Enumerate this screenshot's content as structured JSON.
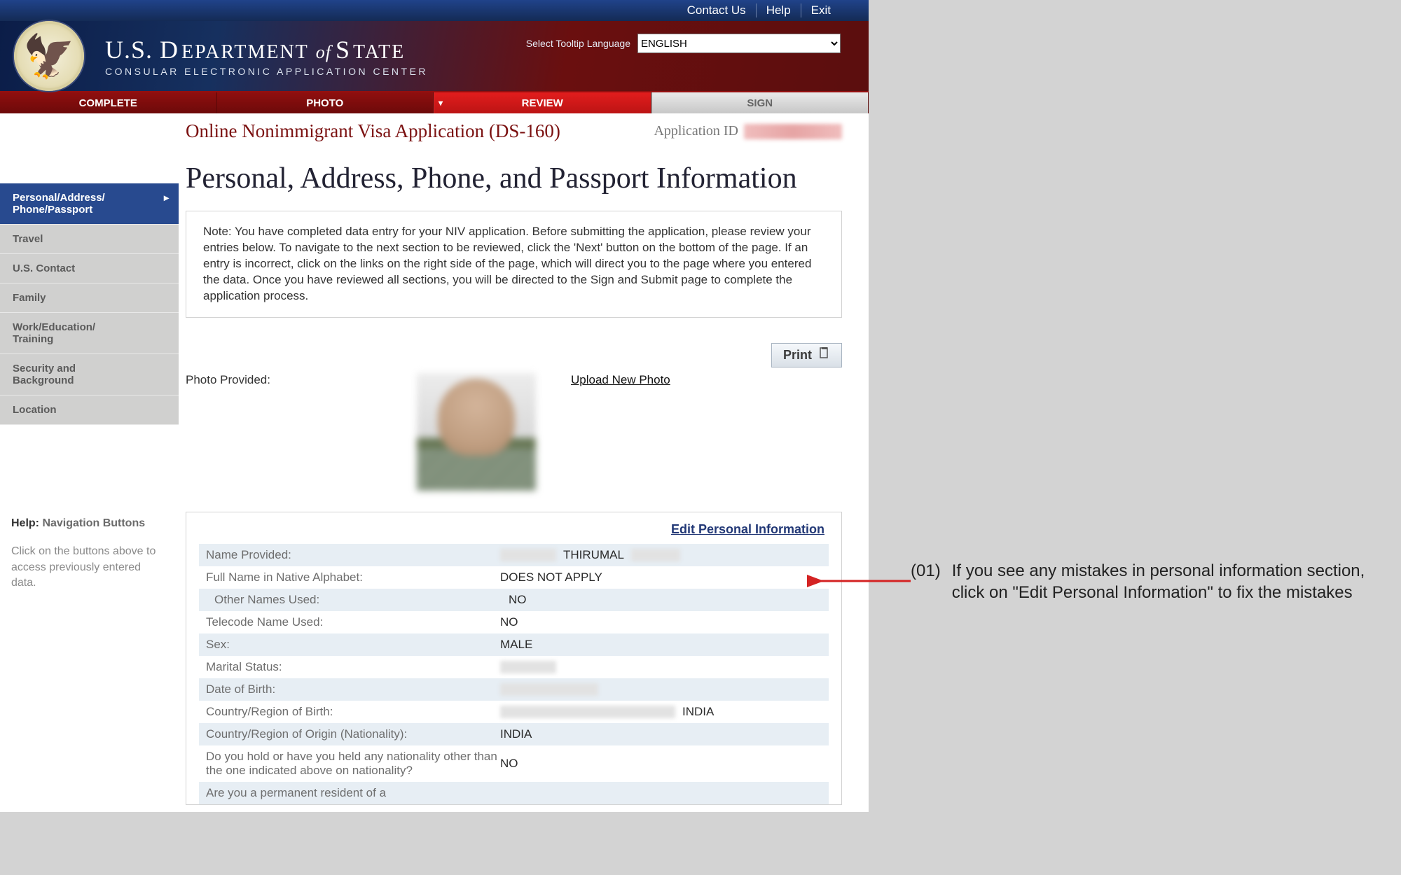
{
  "topbar": {
    "contact": "Contact Us",
    "help": "Help",
    "exit": "Exit"
  },
  "department": {
    "name_html": "U.S. DEPARTMENT of STATE",
    "sub": "CONSULAR ELECTRONIC APPLICATION CENTER"
  },
  "tooltip": {
    "label": "Select Tooltip Language",
    "value": "ENGLISH"
  },
  "tabs": {
    "complete": "COMPLETE",
    "photo": "PHOTO",
    "review": "REVIEW",
    "sign": "SIGN"
  },
  "form": {
    "title": "Online Nonimmigrant Visa Application (DS-160)",
    "appid_label": "Application ID"
  },
  "page": {
    "title": "Personal, Address, Phone, and Passport Information"
  },
  "note": "Note: You have completed data entry for your NIV application. Before submitting the application, please review your entries below. To navigate to the next section to be reviewed, click the 'Next' button on the bottom of the page. If an entry is incorrect, click on the links on the right side of the page, which will direct you to the page where you entered the data. Once you have reviewed all sections, you will be directed to the Sign and Submit page to complete the application process.",
  "print_label": "Print",
  "photo": {
    "label": "Photo Provided:",
    "upload": "Upload New Photo"
  },
  "edit_link": "Edit Personal Information",
  "leftnav": [
    {
      "label": "Personal/Address/\nPhone/Passport",
      "active": true
    },
    {
      "label": "Travel"
    },
    {
      "label": "U.S. Contact"
    },
    {
      "label": "Family"
    },
    {
      "label": "Work/Education/\nTraining"
    },
    {
      "label": "Security and\nBackground"
    },
    {
      "label": "Location"
    }
  ],
  "help": {
    "title_bold": "Help:",
    "title": "Navigation Buttons",
    "text": "Click on the buttons above to access previously entered data."
  },
  "fields": [
    {
      "label": "Name Provided:",
      "redact_before": 80,
      "value": "THIRUMAL",
      "redact_after": 70
    },
    {
      "label": "Full Name in Native Alphabet:",
      "value": "DOES NOT APPLY"
    },
    {
      "label": "Other Names Used:",
      "value": "NO",
      "indent": true
    },
    {
      "label": "Telecode Name Used:",
      "value": "NO"
    },
    {
      "label": "Sex:",
      "value": "MALE"
    },
    {
      "label": "Marital Status:",
      "redact_before": 80,
      "value": ""
    },
    {
      "label": "Date of Birth:",
      "redact_before": 140,
      "value": ""
    },
    {
      "label": "Country/Region of Birth:",
      "redact_before": 250,
      "value": "INDIA"
    },
    {
      "label": "Country/Region of Origin (Nationality):",
      "value": "INDIA"
    },
    {
      "label": "Do you hold or have you held any nationality other than the one indicated above on nationality?",
      "value": "NO"
    },
    {
      "label": "Are you a permanent resident of a",
      "value": ""
    }
  ],
  "annotation": {
    "num": "(01)",
    "text": "If you see any mistakes in personal information section, click on \"Edit Personal Information\" to fix the mistakes"
  }
}
